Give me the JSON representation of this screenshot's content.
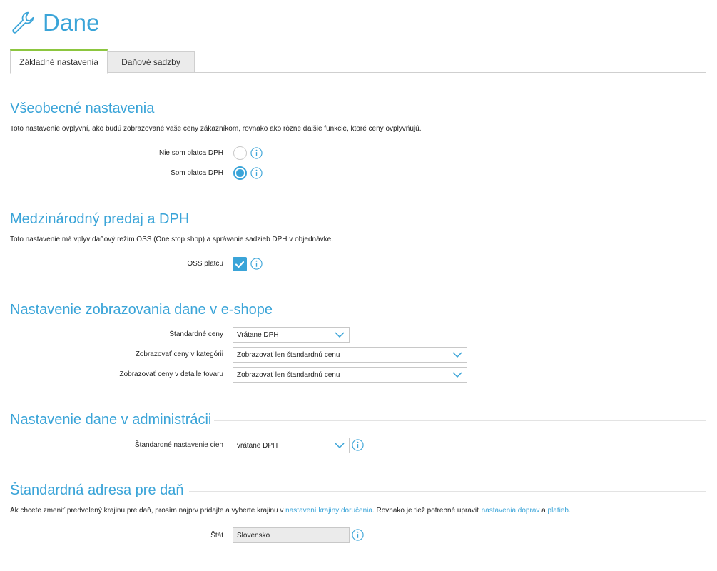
{
  "header": {
    "title": "Dane",
    "icon": "wrench-icon"
  },
  "tabs": [
    {
      "label": "Základné nastavenia",
      "active": true
    },
    {
      "label": "Daňové sadzby",
      "active": false
    }
  ],
  "general": {
    "title": "Všeobecné nastavenia",
    "description": "Toto nastavenie ovplyvní, ako budú zobrazované vaše ceny zákazníkom, rovnako ako rôzne ďalšie funkcie, ktoré ceny ovplyvňujú.",
    "options": [
      {
        "label": "Nie som platca DPH",
        "checked": false
      },
      {
        "label": "Som platca DPH",
        "checked": true
      }
    ]
  },
  "international": {
    "title": "Medzinárodný predaj a DPH",
    "description": "Toto nastavenie má vplyv daňový režim OSS (One stop shop) a správanie sadzieb DPH v objednávke.",
    "oss_label": "OSS platcu",
    "oss_checked": true
  },
  "display": {
    "title": "Nastavenie zobrazovania dane v e-shope",
    "rows": [
      {
        "label": "Štandardné ceny",
        "value": "Vrátane DPH"
      },
      {
        "label": "Zobrazovať ceny v kategórii",
        "value": "Zobrazovať len štandardnú cenu"
      },
      {
        "label": "Zobrazovať ceny v detaile tovaru",
        "value": "Zobrazovať len štandardnú cenu"
      }
    ]
  },
  "admin": {
    "title": "Nastavenie dane v administrácii",
    "label": "Štandardné nastavenie cien",
    "value": "vrátane DPH"
  },
  "address": {
    "title": "Štandardná adresa pre daň",
    "desc_part1": "Ak chcete zmeniť predvolený krajinu pre daň, prosím najprv pridajte a vyberte krajinu v ",
    "link1": "nastavení krajiny doručenia",
    "desc_part2": ". Rovnako je tiež potrebné upraviť ",
    "link2": "nastavenia doprav",
    "desc_part3": " a ",
    "link3": "platieb",
    "desc_part4": ".",
    "country_label": "Štát",
    "country_value": "Slovensko"
  },
  "colors": {
    "accent": "#3aa4d8",
    "tab_active": "#8cc63f",
    "border": "#cfcfcf"
  }
}
